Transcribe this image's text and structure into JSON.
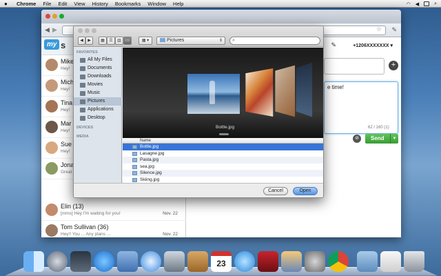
{
  "menubar": {
    "apple": "",
    "app": "Chrome",
    "items": [
      "File",
      "Edit",
      "View",
      "History",
      "Bookmarks",
      "Window",
      "Help"
    ],
    "status_icons": [
      "wifi-icon",
      "volume-icon",
      "battery-icon",
      "search-icon"
    ]
  },
  "browser": {
    "tab_label": "mysms",
    "right_icons": [
      "star-icon",
      "wrench-icon"
    ]
  },
  "app": {
    "logo_text": "my",
    "logo_suffix": "s",
    "phone_number": "+1206XXXXXXX",
    "conversations": [
      {
        "name": "Mike",
        "message": "Hey!",
        "date": ""
      },
      {
        "name": "Mich",
        "message": "Hey!",
        "date": ""
      },
      {
        "name": "Tina",
        "message": "Hey!",
        "date": ""
      },
      {
        "name": "Mar",
        "message": "Hey!",
        "date": ""
      },
      {
        "name": "Sue",
        "message": "Hey!",
        "date": ""
      },
      {
        "name": "Jona",
        "message": "Great",
        "date": ""
      },
      {
        "name": "Elin (13)",
        "message": "[mms] Hey I'm waiting for you!",
        "date": "Nov. 22"
      },
      {
        "name": "Tom Sullivan (36)",
        "message": "Hey!! You ... Any plans ...",
        "date": "Nov. 22"
      }
    ],
    "compose_text": "e time!",
    "char_counter": "62 / 160 (1)",
    "send_label": "Send"
  },
  "dialog": {
    "nav": [
      "◀",
      "▶"
    ],
    "view_modes": [
      "icon-view",
      "list-view",
      "column-view",
      "coverflow-view"
    ],
    "arrange": "arrange",
    "location": "Pictures",
    "search_placeholder": "",
    "sidebar": {
      "favorites_header": "FAVORITES",
      "favorites": [
        "All My Files",
        "Documents",
        "Downloads",
        "Movies",
        "Music",
        "Pictures",
        "Applications",
        "Desktop"
      ],
      "selected": "Pictures",
      "devices_header": "DEVICES",
      "media_header": "MEDIA"
    },
    "coverflow_caption": "Bottle.jpg",
    "list_header": "Name",
    "files": [
      "Bottle.jpg",
      "Lasagne.jpg",
      "Pasta.jpg",
      "sea.jpg",
      "Silence.jpg",
      "Skiing.jpg"
    ],
    "selected_file": "Bottle.jpg",
    "cancel_label": "Cancel",
    "open_label": "Open"
  },
  "dock": {
    "apps": [
      "finder-icon",
      "launchpad-icon",
      "mission-control-icon",
      "app-store-icon",
      "mail-icon",
      "safari-icon",
      "facetime-icon",
      "address-book-icon",
      "calendar-icon",
      "itunes-icon",
      "photo-booth-icon",
      "iphoto-icon",
      "system-preferences-icon",
      "chrome-icon",
      "applications-folder-icon",
      "documents-icon",
      "trash-icon"
    ],
    "calendar_day": "23"
  },
  "colors": {
    "accent": "#3875d7",
    "send_green": "#3a9c35",
    "logo_blue": "#3a9ad9"
  }
}
